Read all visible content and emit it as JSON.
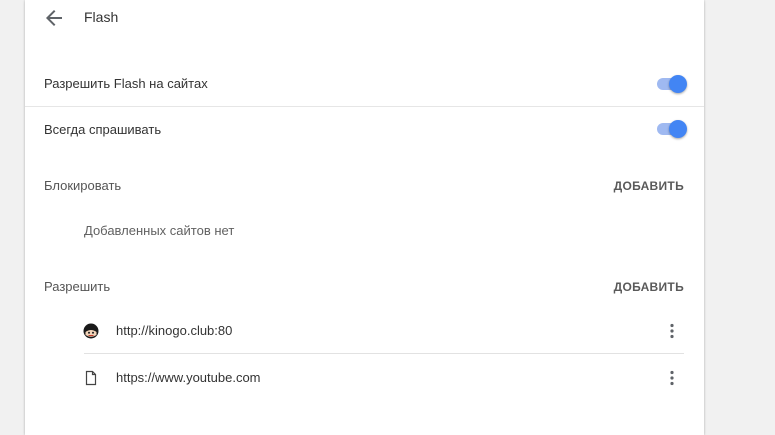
{
  "header": {
    "title": "Flash",
    "back_icon": "arrow-back-icon"
  },
  "settings": {
    "allow_flash_label": "Разрешить Flash на сайтах",
    "allow_flash_enabled": true,
    "always_ask_label": "Всегда спрашивать",
    "always_ask_enabled": true
  },
  "block_section": {
    "title": "Блокировать",
    "add_label": "ДОБАВИТЬ",
    "empty_text": "Добавленных сайтов нет"
  },
  "allow_section": {
    "title": "Разрешить",
    "add_label": "ДОБАВИТЬ",
    "sites": [
      {
        "url": "http://kinogo.club:80",
        "icon": "site-favicon-icon"
      },
      {
        "url": "https://www.youtube.com",
        "icon": "document-icon"
      }
    ]
  },
  "colors": {
    "accent": "#4285f4",
    "toggle_track": "#9fb9f1",
    "background": "#f1f1f1",
    "card": "#ffffff"
  }
}
